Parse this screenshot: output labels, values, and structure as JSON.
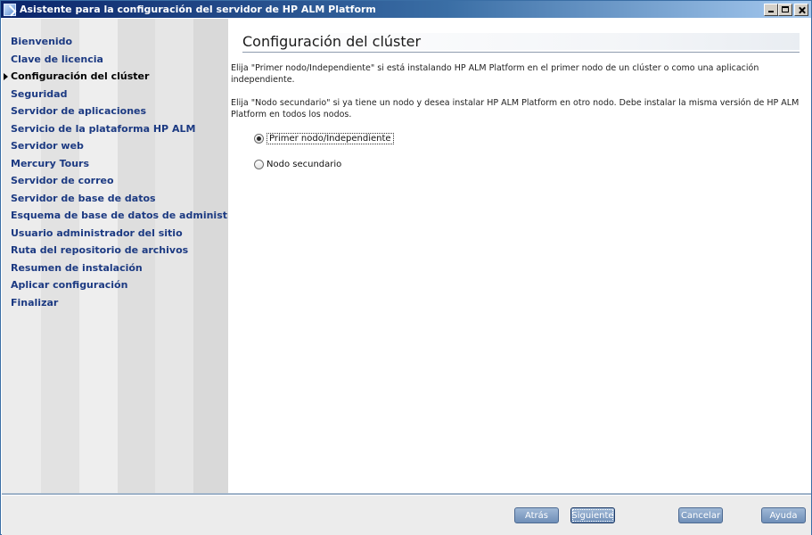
{
  "window": {
    "title": "Asistente para la configuración del servidor de HP ALM Platform",
    "icon": "wizard-app-icon",
    "controls": [
      "minimize-icon",
      "maximize-icon",
      "close-icon"
    ]
  },
  "sidebar": {
    "current_index": 2,
    "items": [
      {
        "label": "Bienvenido"
      },
      {
        "label": "Clave de licencia"
      },
      {
        "label": "Configuración del clúster"
      },
      {
        "label": "Seguridad"
      },
      {
        "label": "Servidor de aplicaciones"
      },
      {
        "label": "Servicio de la plataforma HP ALM"
      },
      {
        "label": "Servidor web"
      },
      {
        "label": "Mercury Tours"
      },
      {
        "label": "Servidor de correo"
      },
      {
        "label": "Servidor de base de datos"
      },
      {
        "label": "Esquema de base de datos de administrac"
      },
      {
        "label": "Usuario administrador del sitio"
      },
      {
        "label": "Ruta del repositorio de archivos"
      },
      {
        "label": "Resumen de instalación"
      },
      {
        "label": "Aplicar configuración"
      },
      {
        "label": "Finalizar"
      }
    ]
  },
  "main": {
    "title": "Configuración del clúster",
    "paragraph1": "Elija \"Primer nodo/Independiente\" si está instalando HP ALM Platform en el primer nodo de un clúster o como una aplicación independiente.",
    "paragraph2": "Elija \"Nodo secundario\" si ya tiene un nodo y desea instalar HP ALM Platform en otro nodo. Debe instalar la misma versión de HP ALM Platform  en todos los nodos.",
    "options": [
      {
        "label": "Primer nodo/Independiente",
        "selected": true
      },
      {
        "label": "Nodo secundario",
        "selected": false
      }
    ]
  },
  "footer": {
    "back_label": "Atrás",
    "next_label": "Siguiente",
    "cancel_label": "Cancelar",
    "help_label": "Ayuda"
  },
  "colors": {
    "sidebar_link": "#1c3a82",
    "button": "#7f9dc4",
    "titlebar_start": "#0a246a"
  }
}
